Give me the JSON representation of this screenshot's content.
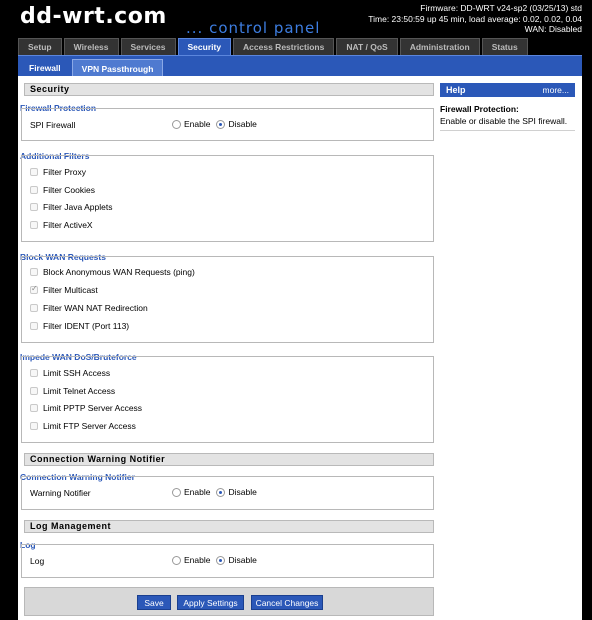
{
  "header": {
    "logo": "dd-wrt.com",
    "logo_sub": "... control panel",
    "firmware": "Firmware: DD-WRT v24-sp2 (03/25/13) std",
    "time": "Time: 23:50:59 up 45 min, load average: 0.02, 0.02, 0.04",
    "wan": "WAN: Disabled"
  },
  "tabs": [
    "Setup",
    "Wireless",
    "Services",
    "Security",
    "Access Restrictions",
    "NAT / QoS",
    "Administration",
    "Status"
  ],
  "active_tab": "Security",
  "subtabs": [
    "Firewall",
    "VPN Passthrough"
  ],
  "active_subtab": "Firewall",
  "sections": {
    "security": "Security",
    "connection_warning": "Connection Warning Notifier",
    "log_management": "Log Management"
  },
  "firewall_protection": {
    "legend": "Firewall Protection",
    "spi_label": "SPI Firewall",
    "enable": "Enable",
    "disable": "Disable",
    "selected": "Disable"
  },
  "additional_filters": {
    "legend": "Additional Filters",
    "items": [
      {
        "label": "Filter Proxy",
        "checked": false
      },
      {
        "label": "Filter Cookies",
        "checked": false
      },
      {
        "label": "Filter Java Applets",
        "checked": false
      },
      {
        "label": "Filter ActiveX",
        "checked": false
      }
    ]
  },
  "block_wan": {
    "legend": "Block WAN Requests",
    "items": [
      {
        "label": "Block Anonymous WAN Requests (ping)",
        "checked": false
      },
      {
        "label": "Filter Multicast",
        "checked": true
      },
      {
        "label": "Filter WAN NAT Redirection",
        "checked": false
      },
      {
        "label": "Filter IDENT (Port 113)",
        "checked": false
      }
    ]
  },
  "impede_wan": {
    "legend": "Impede WAN DoS/Bruteforce",
    "items": [
      {
        "label": "Limit SSH Access",
        "checked": false
      },
      {
        "label": "Limit Telnet Access",
        "checked": false
      },
      {
        "label": "Limit PPTP Server Access",
        "checked": false
      },
      {
        "label": "Limit FTP Server Access",
        "checked": false
      }
    ]
  },
  "connection_warning": {
    "legend": "Connection Warning Notifier",
    "label": "Warning Notifier",
    "enable": "Enable",
    "disable": "Disable",
    "selected": "Disable"
  },
  "log": {
    "legend": "Log",
    "label": "Log",
    "enable": "Enable",
    "disable": "Disable",
    "selected": "Disable"
  },
  "help": {
    "title": "Help",
    "more": "more...",
    "heading": "Firewall Protection:",
    "text": "Enable or disable the SPI firewall."
  },
  "buttons": {
    "save": "Save",
    "apply": "Apply Settings",
    "cancel": "Cancel Changes"
  },
  "colors": {
    "accent": "#2b58b8",
    "header_bg": "#000000",
    "legend": "#2b58b8"
  }
}
